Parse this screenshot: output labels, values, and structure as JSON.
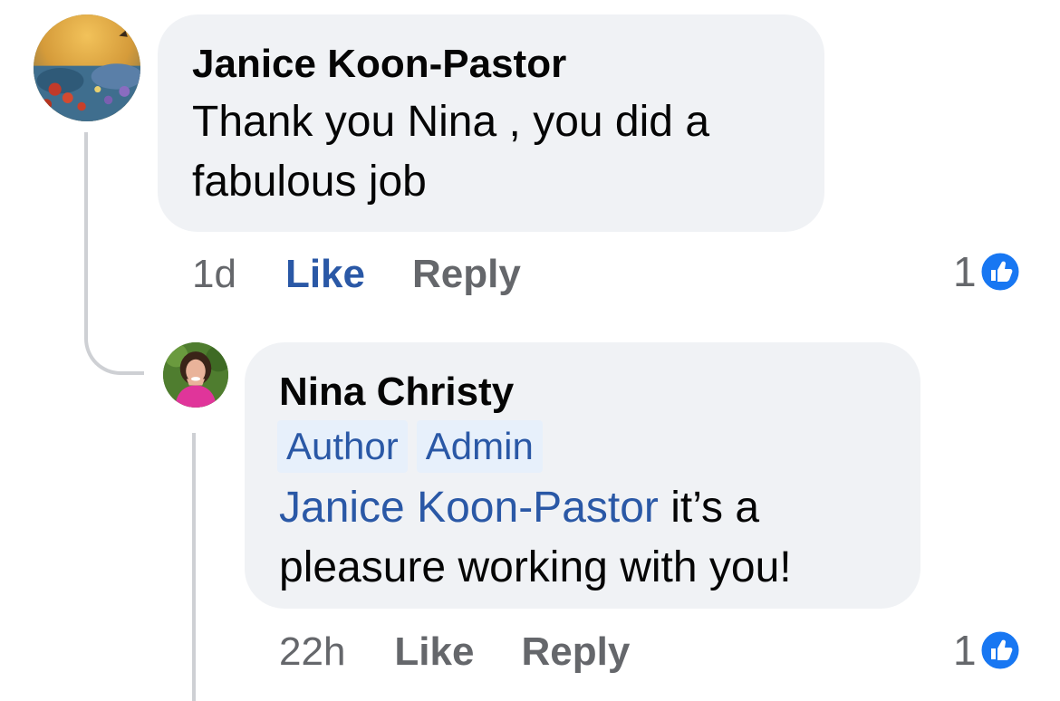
{
  "thread": {
    "comments": [
      {
        "author": "Janice Koon-Pastor",
        "text": "Thank you Nina , you did a fabulous job",
        "time": "1d",
        "like_label": "Like",
        "reply_label": "Reply",
        "like_count": "1",
        "liked_by_viewer": true
      },
      {
        "author": "Nina Christy",
        "badges": [
          "Author",
          "Admin"
        ],
        "mention": "Janice Koon-Pastor",
        "text": " it’s a pleasure working with you!",
        "time": "22h",
        "like_label": "Like",
        "reply_label": "Reply",
        "like_count": "1",
        "liked_by_viewer": false
      }
    ]
  },
  "icons": {
    "reaction": "thumbs-up-icon"
  },
  "colors": {
    "bubble": "#f0f2f5",
    "link_blue": "#2a58a6",
    "muted": "#65676b",
    "like_badge": "#1877f2",
    "badge_bg": "#e7f0fb"
  }
}
